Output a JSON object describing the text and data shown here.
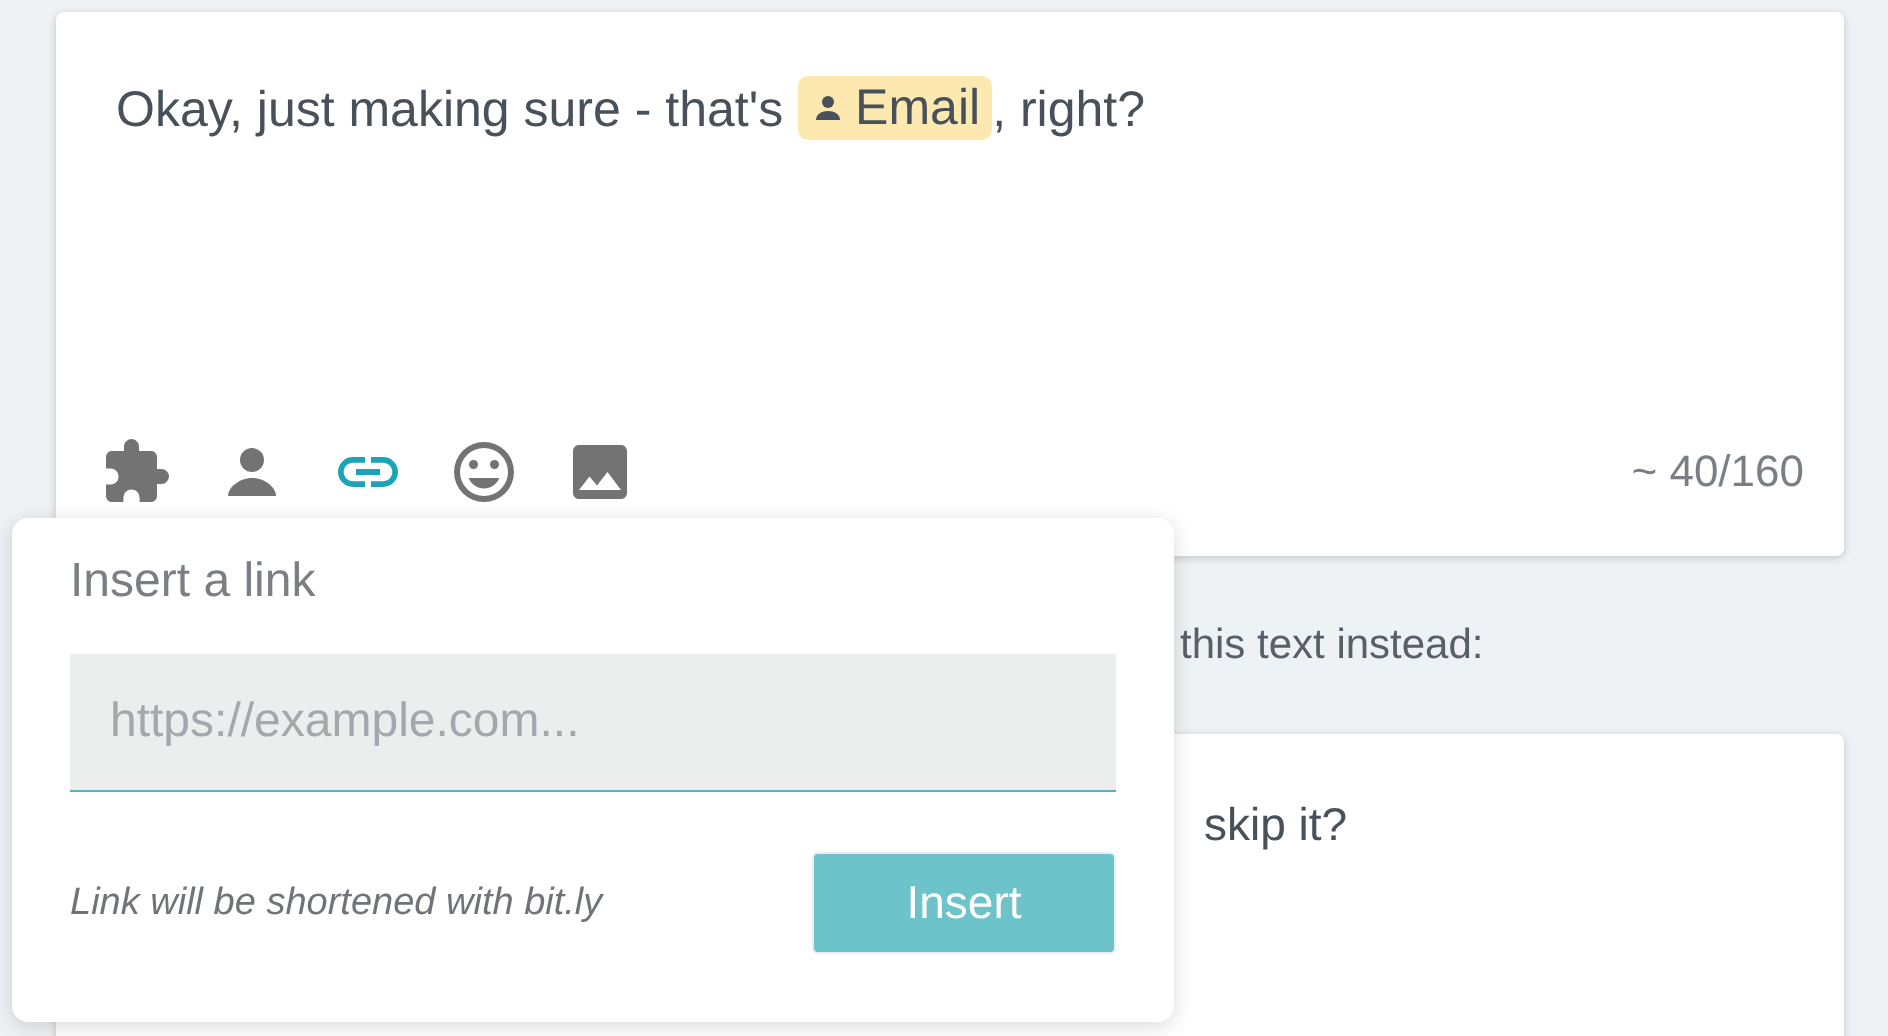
{
  "editor": {
    "message": [
      {
        "kind": "text",
        "text": "Okay, just making sure - that's "
      },
      {
        "kind": "chip",
        "text": "Email"
      },
      {
        "kind": "text",
        "text": ", right?"
      }
    ],
    "tools": [
      {
        "kind": "puzzle",
        "active": false
      },
      {
        "kind": "person",
        "active": false
      },
      {
        "kind": "link",
        "active": true
      },
      {
        "kind": "emoji",
        "active": false
      },
      {
        "kind": "image",
        "active": false
      }
    ],
    "counter": "~ 40/160"
  },
  "behind_label": "this text instead:",
  "second_card": {
    "text": "skip it?"
  },
  "link_popover": {
    "title": "Insert a link",
    "input": {
      "placeholder": "https://example.com..."
    },
    "hint": "Link will be shortened with bit.ly",
    "button": "Insert"
  }
}
